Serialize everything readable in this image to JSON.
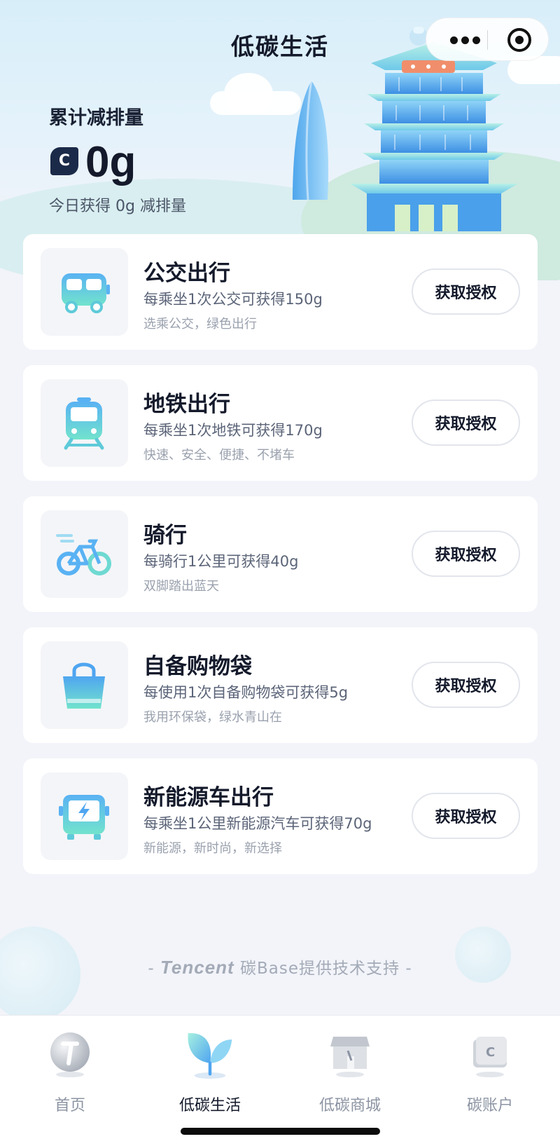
{
  "header": {
    "title": "低碳生活"
  },
  "summary": {
    "label": "累计减排量",
    "badge_letter": "C",
    "total_value": "0g",
    "today_text": "今日获得 0g 减排量"
  },
  "cards": [
    {
      "icon": "bus-icon",
      "title": "公交出行",
      "desc": "每乘坐1次公交可获得150g",
      "note": "选乘公交，绿色出行",
      "button": "获取授权"
    },
    {
      "icon": "subway-icon",
      "title": "地铁出行",
      "desc": "每乘坐1次地铁可获得170g",
      "note": "快速、安全、便捷、不堵车",
      "button": "获取授权"
    },
    {
      "icon": "bicycle-icon",
      "title": "骑行",
      "desc": "每骑行1公里可获得40g",
      "note": "双脚踏出蓝天",
      "button": "获取授权"
    },
    {
      "icon": "shopping-bag-icon",
      "title": "自备购物袋",
      "desc": "每使用1次自备购物袋可获得5g",
      "note": "我用环保袋，绿水青山在",
      "button": "获取授权"
    },
    {
      "icon": "electric-bus-icon",
      "title": "新能源车出行",
      "desc": "每乘坐1公里新能源汽车可获得70g",
      "note": "新能源，新时尚，新选择",
      "button": "获取授权"
    }
  ],
  "footer": {
    "brand": "Tencent",
    "credit": "碳Base提供技术支持",
    "dash": "-"
  },
  "tabs": [
    {
      "icon": "home-tab-icon",
      "label": "首页",
      "active": false
    },
    {
      "icon": "leaf-tab-icon",
      "label": "低碳生活",
      "active": true
    },
    {
      "icon": "store-tab-icon",
      "label": "低碳商城",
      "active": false
    },
    {
      "icon": "wallet-tab-icon",
      "label": "碳账户",
      "active": false
    }
  ],
  "colors": {
    "accent_blue": "#5ab4f0",
    "accent_teal": "#6fe0cf",
    "title_text": "#141a2b",
    "secondary_text": "#5b6478",
    "muted_text": "#9aa1ae"
  }
}
